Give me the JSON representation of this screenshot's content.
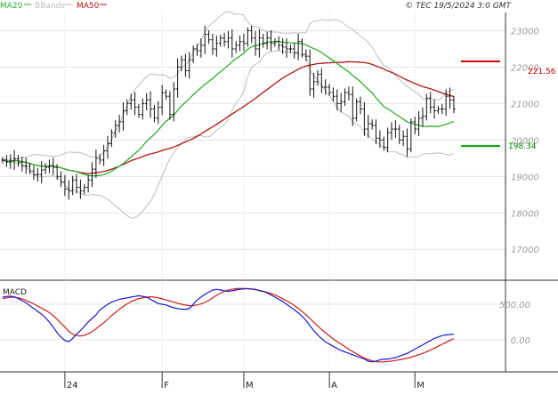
{
  "chart_data": [
    {
      "type": "ohlc",
      "legend": [
        {
          "label": "MA20",
          "color": "#2eae2e"
        },
        {
          "label": "BBands",
          "color": "#bdbdbd"
        },
        {
          "label": "MA50",
          "color": "#b01414"
        }
      ],
      "copyright": "© TEC 19/5/2024 3:0 GMT",
      "y_ticks": [
        17000,
        18000,
        19000,
        20000,
        21000,
        22000,
        23000
      ],
      "ylim": [
        16200,
        23500
      ],
      "x_ticks": [
        {
          "label": "24",
          "index": 16
        },
        {
          "label": "F",
          "index": 41
        },
        {
          "label": "M",
          "index": 62
        },
        {
          "label": "A",
          "index": 84
        },
        {
          "label": "M",
          "index": 106
        }
      ],
      "resistance": {
        "label": "221.56",
        "value": 22156,
        "color": "#d40000"
      },
      "support": {
        "label": "198.34",
        "value": 19834,
        "color": "#00a000"
      },
      "series": {
        "close": [
          19450,
          19400,
          19420,
          19480,
          19380,
          19300,
          19280,
          19150,
          19050,
          19050,
          19180,
          19250,
          19300,
          19250,
          19000,
          18850,
          18650,
          18600,
          18900,
          18700,
          18600,
          18700,
          18900,
          19200,
          19500,
          19450,
          19700,
          19900,
          20200,
          20400,
          20500,
          20800,
          21000,
          21100,
          20900,
          20700,
          21000,
          21100,
          20850,
          20600,
          20900,
          21300,
          21200,
          20700,
          21400,
          22000,
          22200,
          21900,
          22200,
          22500,
          22450,
          22600,
          22900,
          22750,
          22500,
          22650,
          22800,
          22700,
          22800,
          22500,
          22600,
          22700,
          22650,
          23000,
          22800,
          22500,
          22800,
          22650,
          22800,
          22650,
          22700,
          22600,
          22550,
          22500,
          22500,
          22400,
          22700,
          22350,
          22300,
          21400,
          21600,
          21800,
          21450,
          21450,
          21300,
          21200,
          21000,
          21050,
          21300,
          21250,
          20600,
          21050,
          20850,
          20300,
          20450,
          20400,
          20050,
          20000,
          19800,
          20200,
          20300,
          20300,
          20000,
          20100,
          19750,
          20500,
          20300,
          20600,
          20650,
          21150,
          20900,
          20800,
          20850,
          20850,
          21200,
          21100,
          20850
        ]
      },
      "macd": {
        "label": "MACD",
        "y_ticks": [
          0,
          500
        ],
        "ylim": [
          -450,
          800
        ],
        "line_color": "#1a1acc",
        "signal_color": "#cc1a1a",
        "macd": [
          600,
          610,
          615,
          605,
          580,
          550,
          520,
          480,
          440,
          400,
          360,
          310,
          250,
          180,
          100,
          40,
          -10,
          -25,
          20,
          80,
          130,
          190,
          250,
          300,
          350,
          420,
          460,
          500,
          530,
          550,
          570,
          580,
          590,
          600,
          610,
          620,
          610,
          600,
          570,
          540,
          510,
          500,
          490,
          470,
          450,
          440,
          430,
          430,
          440,
          500,
          560,
          600,
          640,
          670,
          700,
          710,
          700,
          690,
          680,
          690,
          700,
          710,
          715,
          720,
          715,
          710,
          690,
          680,
          660,
          630,
          600,
          570,
          540,
          500,
          460,
          420,
          380,
          330,
          270,
          200,
          130,
          70,
          20,
          -30,
          -60,
          -90,
          -120,
          -150,
          -170,
          -190,
          -210,
          -230,
          -250,
          -270,
          -300,
          -310,
          -300,
          -280,
          -270,
          -270,
          -260,
          -250,
          -230,
          -210,
          -190,
          -160,
          -130,
          -100,
          -70,
          -40,
          -10,
          20,
          40,
          60,
          70,
          75,
          80
        ],
        "signal": [
          580,
          590,
          600,
          600,
          590,
          575,
          555,
          530,
          505,
          475,
          445,
          415,
          385,
          340,
          290,
          230,
          180,
          120,
          80,
          60,
          55,
          65,
          85,
          115,
          155,
          200,
          240,
          290,
          340,
          385,
          430,
          470,
          505,
          535,
          560,
          580,
          590,
          600,
          605,
          600,
          590,
          575,
          560,
          545,
          530,
          515,
          500,
          490,
          480,
          480,
          490,
          505,
          525,
          555,
          590,
          625,
          655,
          680,
          700,
          710,
          720,
          722,
          722,
          718,
          712,
          705,
          695,
          682,
          668,
          650,
          630,
          605,
          578,
          550,
          518,
          482,
          442,
          398,
          352,
          300,
          248,
          196,
          146,
          100,
          55,
          15,
          -25,
          -60,
          -95,
          -130,
          -165,
          -198,
          -228,
          -255,
          -277,
          -295,
          -305,
          -310,
          -310,
          -305,
          -298,
          -290,
          -280,
          -270,
          -258,
          -244,
          -228,
          -210,
          -190,
          -168,
          -144,
          -118,
          -90,
          -62,
          -35,
          -8,
          15
        ]
      }
    }
  ]
}
